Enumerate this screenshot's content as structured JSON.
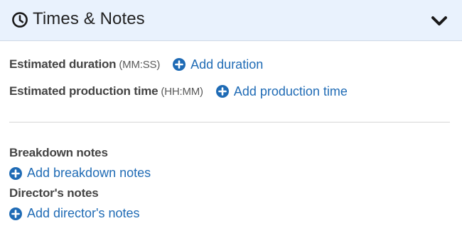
{
  "header": {
    "title": "Times & Notes",
    "icon": "clock-icon",
    "toggle_icon": "chevron-down-icon"
  },
  "times": {
    "duration": {
      "label": "Estimated duration",
      "hint": "(MM:SS)",
      "action": "Add duration"
    },
    "production": {
      "label": "Estimated production time",
      "hint": "(HH:MM)",
      "action": "Add production time"
    }
  },
  "notes": {
    "breakdown": {
      "label": "Breakdown notes",
      "action": "Add breakdown notes"
    },
    "director": {
      "label": "Director's notes",
      "action": "Add director's notes"
    }
  },
  "colors": {
    "header_bg": "#e9f2fd",
    "link": "#1f6bb5",
    "label": "#444444"
  }
}
